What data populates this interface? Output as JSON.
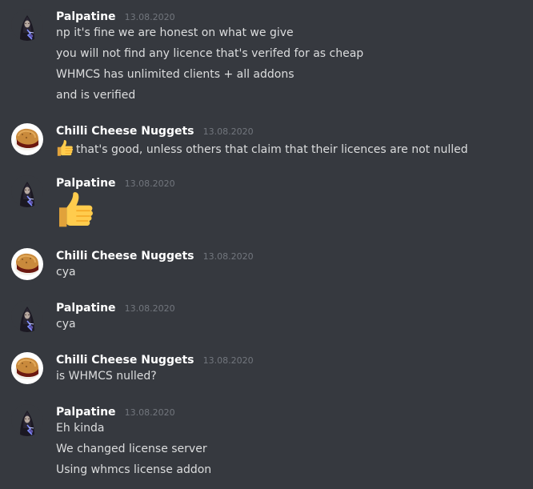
{
  "colors": {
    "background": "#36393f",
    "username": "#ffffff",
    "timestamp": "#72767d",
    "text": "#dcddde"
  },
  "messages": [
    {
      "author": "Palpatine",
      "timestamp": "13.08.2020",
      "avatar_icon": "palpatine-avatar-icon",
      "lines": [
        "np it's fine we are honest on what we give",
        "you will not find any licence that's verifed for as cheap",
        "WHMCS has unlimited clients + all addons",
        "and is verified"
      ]
    },
    {
      "author": "Chilli Cheese Nuggets",
      "timestamp": "13.08.2020",
      "avatar_icon": "nugget-avatar-icon",
      "emoji_icon": "thumbs-up-emoji-icon",
      "lines": [
        "that's good, unless others that claim that their licences are not nulled"
      ]
    },
    {
      "author": "Palpatine",
      "timestamp": "13.08.2020",
      "avatar_icon": "palpatine-avatar-icon",
      "big_emoji_icon": "thumbs-up-emoji-icon"
    },
    {
      "author": "Chilli Cheese Nuggets",
      "timestamp": "13.08.2020",
      "avatar_icon": "nugget-avatar-icon",
      "lines": [
        "cya"
      ]
    },
    {
      "author": "Palpatine",
      "timestamp": "13.08.2020",
      "avatar_icon": "palpatine-avatar-icon",
      "lines": [
        "cya"
      ]
    },
    {
      "author": "Chilli Cheese Nuggets",
      "timestamp": "13.08.2020",
      "avatar_icon": "nugget-avatar-icon",
      "lines": [
        "is WHMCS nulled?"
      ]
    },
    {
      "author": "Palpatine",
      "timestamp": "13.08.2020",
      "avatar_icon": "palpatine-avatar-icon",
      "lines": [
        "Eh kinda",
        "We changed license server",
        "Using whmcs license addon"
      ]
    }
  ]
}
